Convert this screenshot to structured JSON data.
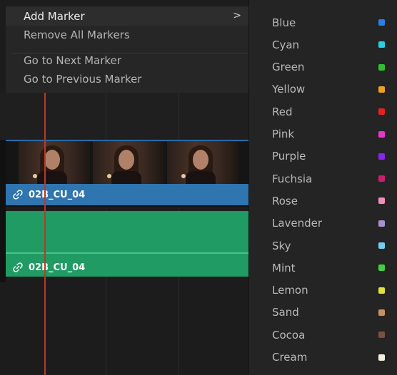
{
  "main_menu": {
    "items": [
      {
        "label": "Add Marker",
        "has_submenu": true
      },
      {
        "label": "Remove All Markers"
      },
      {
        "label": "Go to Next Marker"
      },
      {
        "label": "Go to Previous Marker"
      }
    ],
    "arrow_glyph": ">"
  },
  "color_menu": {
    "items": [
      {
        "label": "Blue",
        "color": "#2b7fe0"
      },
      {
        "label": "Cyan",
        "color": "#2bd0e0"
      },
      {
        "label": "Green",
        "color": "#2ec22e"
      },
      {
        "label": "Yellow",
        "color": "#f0a020"
      },
      {
        "label": "Red",
        "color": "#e82020"
      },
      {
        "label": "Pink",
        "color": "#e838c8"
      },
      {
        "label": "Purple",
        "color": "#8a28e8"
      },
      {
        "label": "Fuchsia",
        "color": "#c8206a"
      },
      {
        "label": "Rose",
        "color": "#f090b8"
      },
      {
        "label": "Lavender",
        "color": "#a890d0"
      },
      {
        "label": "Sky",
        "color": "#70d0f0"
      },
      {
        "label": "Mint",
        "color": "#40d040"
      },
      {
        "label": "Lemon",
        "color": "#e0e040"
      },
      {
        "label": "Sand",
        "color": "#c89060"
      },
      {
        "label": "Cocoa",
        "color": "#7a5040"
      },
      {
        "label": "Cream",
        "color": "#f4efe0"
      }
    ]
  },
  "timeline": {
    "video_clip_name": "02B_CU_04",
    "audio_clip_name": "02B_CU_04",
    "video_track_color": "#2f75b0",
    "audio_track_color": "#1f9b63",
    "playhead_color": "#b63a2d",
    "link_icon": "link-icon"
  }
}
